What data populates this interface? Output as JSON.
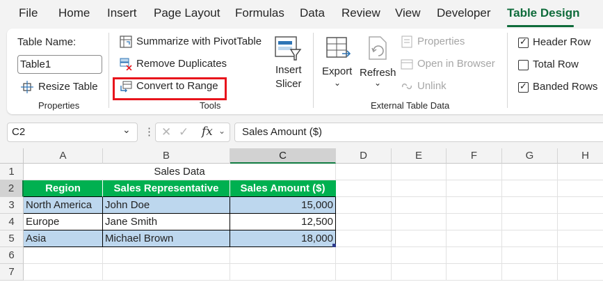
{
  "menu": {
    "tabs": [
      "File",
      "Home",
      "Insert",
      "Page Layout",
      "Formulas",
      "Data",
      "Review",
      "View",
      "Developer",
      "Table Design"
    ],
    "active_tab": "Table Design"
  },
  "ribbon": {
    "properties": {
      "table_name_label": "Table Name:",
      "table_name_value": "Table1",
      "resize_label": "Resize Table",
      "group_label": "Properties"
    },
    "tools": {
      "summarize_label": "Summarize with PivotTable",
      "remove_duplicates_label": "Remove Duplicates",
      "convert_label": "Convert to Range",
      "insert_slicer_line1": "Insert",
      "insert_slicer_line2": "Slicer",
      "group_label": "Tools"
    },
    "external": {
      "export_label": "Export",
      "refresh_label": "Refresh",
      "properties_label": "Properties",
      "open_browser_label": "Open in Browser",
      "unlink_label": "Unlink",
      "group_label": "External Table Data"
    },
    "style_options": {
      "header_row_label": "Header Row",
      "header_row_checked": true,
      "total_row_label": "Total Row",
      "total_row_checked": false,
      "banded_rows_label": "Banded Rows",
      "banded_rows_checked": true
    },
    "colors": {
      "accent": "#0e6b3a",
      "highlight": "#e8141c"
    }
  },
  "formula_bar": {
    "name_box": "C2",
    "formula": "Sales Amount ($)",
    "fx": "fx"
  },
  "sheet": {
    "columns": [
      "A",
      "B",
      "C",
      "D",
      "E",
      "F",
      "G",
      "H"
    ],
    "rows": [
      "1",
      "2",
      "3",
      "4",
      "5",
      "6",
      "7"
    ],
    "title": "Sales Data",
    "headers": [
      "Region",
      "Sales Representative",
      "Sales Amount ($)"
    ],
    "data": [
      [
        "North America",
        "John Doe",
        "15,000"
      ],
      [
        "Europe",
        "Jane Smith",
        "12,500"
      ],
      [
        "Asia",
        "Michael Brown",
        "18,000"
      ]
    ],
    "colors": {
      "header_fill": "#00b050",
      "band_fill": "#bdd7ee"
    }
  }
}
